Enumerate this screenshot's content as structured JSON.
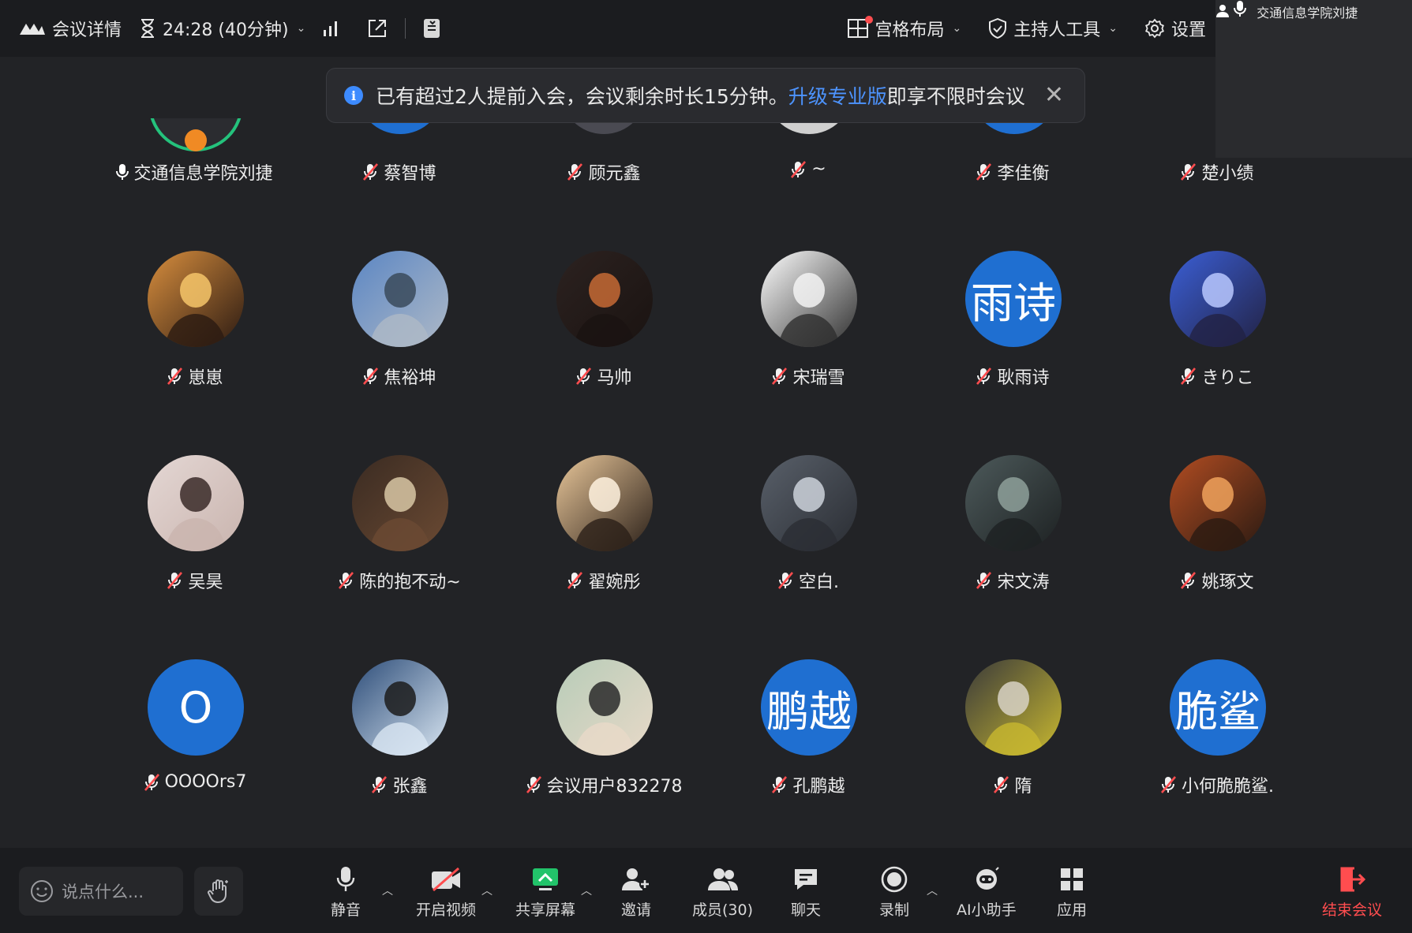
{
  "topbar": {
    "meeting_details": "会议详情",
    "timer": "24:28 (40分钟)",
    "layout": "宫格布局",
    "host_tools": "主持人工具",
    "settings": "设置"
  },
  "notice": {
    "text_before": "已有超过2人提前入会，会议剩余时长15分钟。",
    "link": "升级专业版",
    "text_after": "即享不限时会议"
  },
  "self_view": {
    "name": "交通信息学院刘捷"
  },
  "top_row": [
    {
      "name": "交通信息学院刘捷",
      "mic": "on"
    },
    {
      "name": "蔡智博",
      "mic": "muted"
    },
    {
      "name": "顾元鑫",
      "mic": "muted"
    },
    {
      "name": "~",
      "mic": "muted"
    },
    {
      "name": "李佳衡",
      "mic": "muted"
    },
    {
      "name": "楚小绩",
      "mic": "muted"
    }
  ],
  "participants": [
    {
      "name": "崽崽",
      "avatar": "photo"
    },
    {
      "name": "焦裕坤",
      "avatar": "photo"
    },
    {
      "name": "马帅",
      "avatar": "photo"
    },
    {
      "name": "宋瑞雪",
      "avatar": "photo"
    },
    {
      "name": "耿雨诗",
      "avatar": "text",
      "avatar_text": "雨诗"
    },
    {
      "name": "きりこ",
      "avatar": "photo"
    },
    {
      "name": "吴昊",
      "avatar": "photo"
    },
    {
      "name": "陈的抱不动~",
      "avatar": "photo"
    },
    {
      "name": "翟婉彤",
      "avatar": "photo"
    },
    {
      "name": "空白.",
      "avatar": "photo"
    },
    {
      "name": "宋文涛",
      "avatar": "photo"
    },
    {
      "name": "姚琢文",
      "avatar": "photo"
    },
    {
      "name": "OOOOrs7",
      "avatar": "text",
      "avatar_text": "O"
    },
    {
      "name": "张鑫",
      "avatar": "photo"
    },
    {
      "name": "会议用户832278",
      "avatar": "photo"
    },
    {
      "name": "孔鹏越",
      "avatar": "text",
      "avatar_text": "鹏越"
    },
    {
      "name": "隋",
      "avatar": "photo"
    },
    {
      "name": "小何脆脆鲨.",
      "avatar": "text",
      "avatar_text": "脆鲨"
    }
  ],
  "bottombar": {
    "chat_placeholder": "说点什么...",
    "mute": "静音",
    "video": "开启视频",
    "share": "共享屏幕",
    "invite": "邀请",
    "members": "成员(30)",
    "chat": "聊天",
    "record": "录制",
    "ai": "AI小助手",
    "apps": "应用",
    "end": "结束会议"
  },
  "colors": {
    "accent": "#1f6fd1",
    "link": "#4d94ff",
    "danger": "#ff4d4f",
    "share_green": "#22c36a"
  }
}
